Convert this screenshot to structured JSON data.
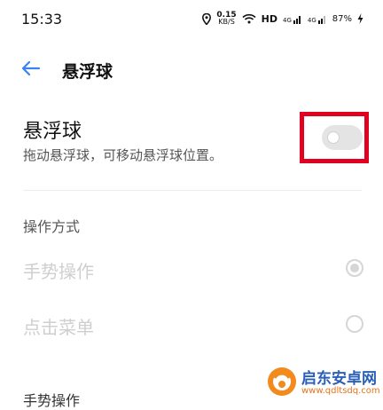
{
  "status_bar": {
    "time": "15:33",
    "net_speed": "0.15",
    "net_unit": "KB/S",
    "hd_label": "HD",
    "signal1_label": "4G",
    "signal2_label": "4G",
    "battery": "87%"
  },
  "header": {
    "title": "悬浮球"
  },
  "floating_ball": {
    "title": "悬浮球",
    "description": "拖动悬浮球，可移动悬浮球位置。",
    "enabled": false
  },
  "operation": {
    "section_label": "操作方式",
    "options": [
      {
        "label": "手势操作",
        "selected": true
      },
      {
        "label": "点击菜单",
        "selected": false
      }
    ]
  },
  "next_section_label": "手势操作",
  "watermark": {
    "title": "启东安卓网",
    "url": "www.qdltsdq.com"
  },
  "colors": {
    "accent": "#3b82f6",
    "highlight": "#e00020",
    "disabled_text": "#cfcfcf"
  }
}
